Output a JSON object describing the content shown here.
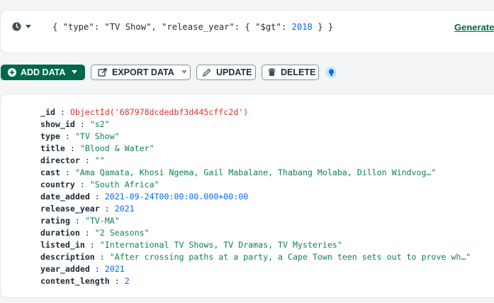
{
  "filter_bar": {
    "query_parts": [
      "{ \"type\": \"TV Show\", \"release_year\": { \"$gt\": ",
      "2018",
      " } }"
    ],
    "generate_label": "Generate",
    "history_icon": "clock-icon",
    "dropdown_icon": "caret-down-icon"
  },
  "toolbar": {
    "add_data_label": "ADD DATA",
    "export_data_label": "EXPORT DATA",
    "update_label": "UPDATE",
    "delete_label": "DELETE",
    "info_icon": "lightbulb-icon"
  },
  "colors": {
    "primary_green": "#00684a",
    "string_value": "#12824d",
    "number_value": "#016bf8",
    "object_id": "#db3030"
  },
  "document": {
    "fields": [
      {
        "key": "_id",
        "value": "ObjectId('687978dcdedbf3d445cffc2d')",
        "kind": "oid"
      },
      {
        "key": "show_id",
        "value": "\"s2\"",
        "kind": "string"
      },
      {
        "key": "type",
        "value": "\"TV Show\"",
        "kind": "string"
      },
      {
        "key": "title",
        "value": "\"Blood & Water\"",
        "kind": "string"
      },
      {
        "key": "director",
        "value": "\"\"",
        "kind": "string"
      },
      {
        "key": "cast",
        "value": "\"Ama Qamata, Khosi Ngema, Gail Mabalane, Thabang Molaba, Dillon Windvog…\"",
        "kind": "string"
      },
      {
        "key": "country",
        "value": "\"South Africa\"",
        "kind": "string"
      },
      {
        "key": "date_added",
        "value": "2021-09-24T00:00:00.000+00:00",
        "kind": "date"
      },
      {
        "key": "release_year",
        "value": "2021",
        "kind": "number"
      },
      {
        "key": "rating",
        "value": "\"TV-MA\"",
        "kind": "string"
      },
      {
        "key": "duration",
        "value": "\"2 Seasons\"",
        "kind": "string"
      },
      {
        "key": "listed_in",
        "value": "\"International TV Shows, TV Dramas, TV Mysteries\"",
        "kind": "string"
      },
      {
        "key": "description",
        "value": "\"After crossing paths at a party, a Cape Town teen sets out to prove wh…\"",
        "kind": "string"
      },
      {
        "key": "year_added",
        "value": "2021",
        "kind": "number"
      },
      {
        "key": "content_length",
        "value": "2",
        "kind": "number"
      }
    ]
  }
}
